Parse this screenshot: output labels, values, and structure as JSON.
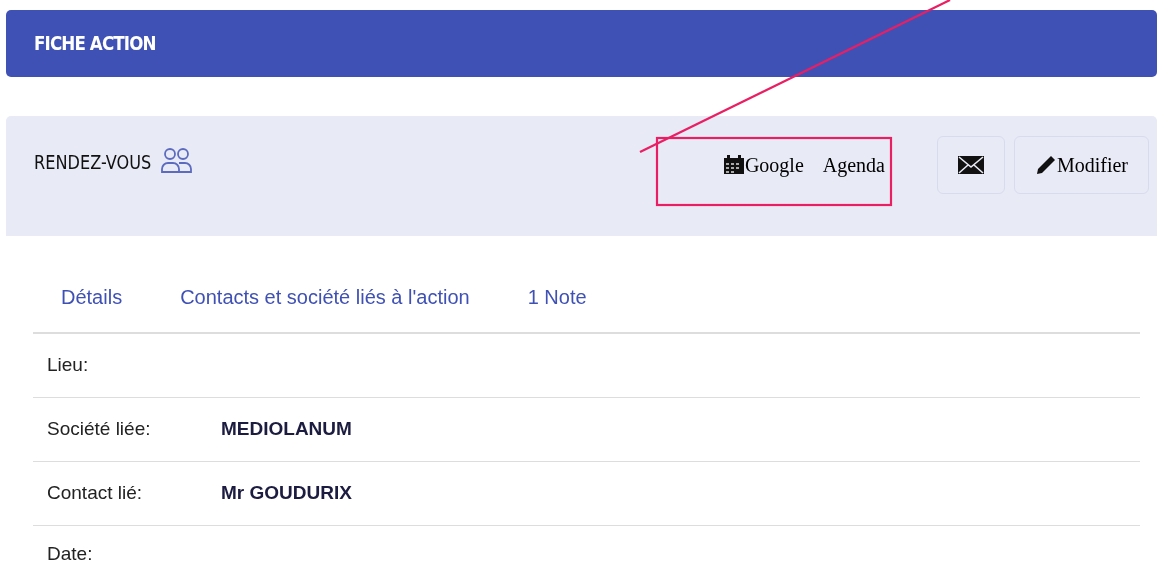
{
  "header": {
    "title": "FICHE ACTION"
  },
  "card": {
    "title": "RENDEZ-VOUS",
    "buttons": [
      {
        "kind": "calendar",
        "label": "Google    Agenda"
      },
      {
        "kind": "mail"
      },
      {
        "kind": "edit",
        "label": "Modifier"
      }
    ],
    "tabs": [
      {
        "label": "Détails"
      },
      {
        "label": "Contacts et société liés à l'action"
      },
      {
        "label": "1 Note"
      }
    ],
    "fields": [
      {
        "label": "Lieu:"
      },
      {
        "label": "Société liée:",
        "value": "MEDIOLANUM"
      },
      {
        "label": "Contact lié:",
        "value": "Mr GOUDURIX"
      },
      {
        "label": "Date:"
      }
    ]
  },
  "annotations": {
    "line": true,
    "rectangle": true
  }
}
